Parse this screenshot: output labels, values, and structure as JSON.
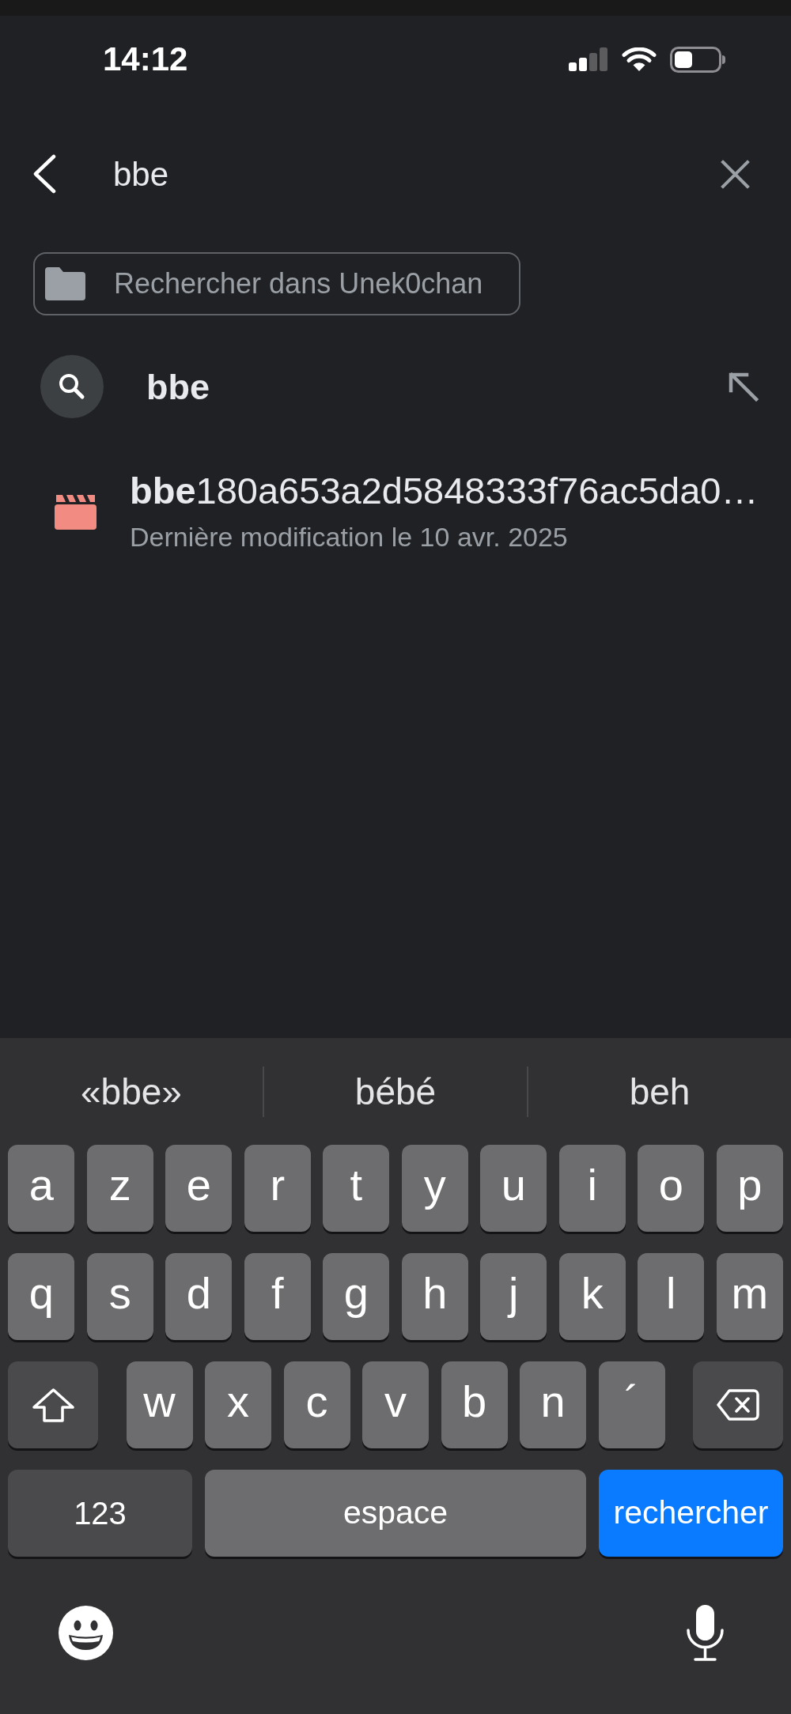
{
  "status_bar": {
    "time": "14:12"
  },
  "search_bar": {
    "value": "bbe"
  },
  "scope_chip": {
    "label": "Rechercher dans Unek0chan"
  },
  "suggestions": [
    {
      "kind": "query",
      "text": "bbe"
    },
    {
      "kind": "file",
      "title": "**bbe**180a653a2d5848333f76ac5da0…",
      "subtitle": "Dernière modification le 10 avr. 2025"
    }
  ],
  "keyboard": {
    "predictions": [
      "«bbe»",
      "bébé",
      "beh"
    ],
    "key_rows": [
      {
        "keys": [
          {
            "kind": "letter",
            "label": "a"
          },
          {
            "kind": "letter",
            "label": "z"
          },
          {
            "kind": "letter",
            "label": "e"
          },
          {
            "kind": "letter",
            "label": "r"
          },
          {
            "kind": "letter",
            "label": "t"
          },
          {
            "kind": "letter",
            "label": "y"
          },
          {
            "kind": "letter",
            "label": "u"
          },
          {
            "kind": "letter",
            "label": "i"
          },
          {
            "kind": "letter",
            "label": "o"
          },
          {
            "kind": "letter",
            "label": "p"
          }
        ]
      },
      {
        "keys": [
          {
            "kind": "letter",
            "label": "q"
          },
          {
            "kind": "letter",
            "label": "s"
          },
          {
            "kind": "letter",
            "label": "d"
          },
          {
            "kind": "letter",
            "label": "f"
          },
          {
            "kind": "letter",
            "label": "g"
          },
          {
            "kind": "letter",
            "label": "h"
          },
          {
            "kind": "letter",
            "label": "j"
          },
          {
            "kind": "letter",
            "label": "k"
          },
          {
            "kind": "letter",
            "label": "l"
          },
          {
            "kind": "letter",
            "label": "m"
          }
        ]
      },
      {
        "keys": [
          {
            "kind": "shift"
          },
          {
            "kind": "letter",
            "label": "w"
          },
          {
            "kind": "letter",
            "label": "x"
          },
          {
            "kind": "letter",
            "label": "c"
          },
          {
            "kind": "letter",
            "label": "v"
          },
          {
            "kind": "letter",
            "label": "b"
          },
          {
            "kind": "letter",
            "label": "n"
          },
          {
            "kind": "letter",
            "label": "´"
          },
          {
            "kind": "delete"
          }
        ]
      },
      {
        "keys": [
          {
            "kind": "mode",
            "label": "123"
          },
          {
            "kind": "space",
            "label": "espace"
          },
          {
            "kind": "action",
            "label": "rechercher"
          }
        ]
      }
    ]
  }
}
